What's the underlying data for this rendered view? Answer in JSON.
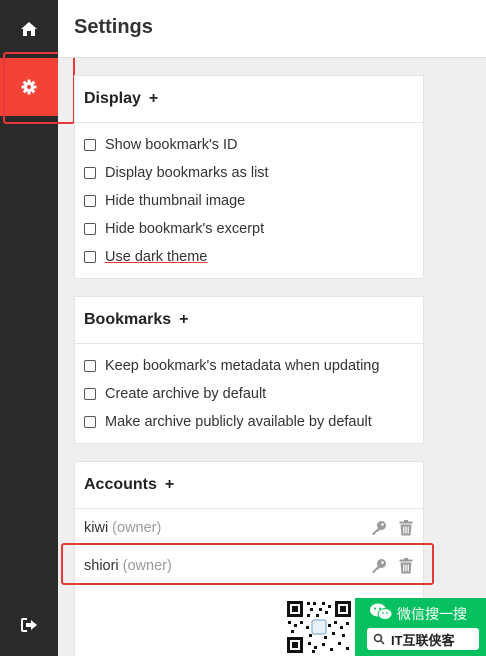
{
  "header": {
    "title": "Settings"
  },
  "sidebar": {
    "items": [
      {
        "icon": "home-icon"
      },
      {
        "icon": "gear-icon",
        "active": true
      },
      {
        "icon": "logout-icon"
      }
    ]
  },
  "display": {
    "title": "Display",
    "plus": "+",
    "options": [
      {
        "label": "Show bookmark's ID",
        "checked": false
      },
      {
        "label": "Display bookmarks as list",
        "checked": false
      },
      {
        "label": "Hide thumbnail image",
        "checked": false
      },
      {
        "label": "Hide bookmark's excerpt",
        "checked": false
      },
      {
        "label": "Use dark theme",
        "checked": false
      }
    ]
  },
  "bookmarks": {
    "title": "Bookmarks",
    "plus": "+",
    "options": [
      {
        "label": "Keep bookmark's metadata when updating",
        "checked": false
      },
      {
        "label": "Create archive by default",
        "checked": false
      },
      {
        "label": "Make archive publicly available by default",
        "checked": false
      }
    ]
  },
  "accounts": {
    "title": "Accounts",
    "plus": "+",
    "users": [
      {
        "name": "kiwi",
        "role": "(owner)"
      },
      {
        "name": "shiori",
        "role": "(owner)"
      }
    ]
  },
  "watermark": {
    "search_text": "微信搜一搜",
    "account": "IT互联侠客"
  },
  "colors": {
    "accent": "#f44336",
    "sidebar": "#2a2a2a",
    "wechat": "#07c160"
  }
}
